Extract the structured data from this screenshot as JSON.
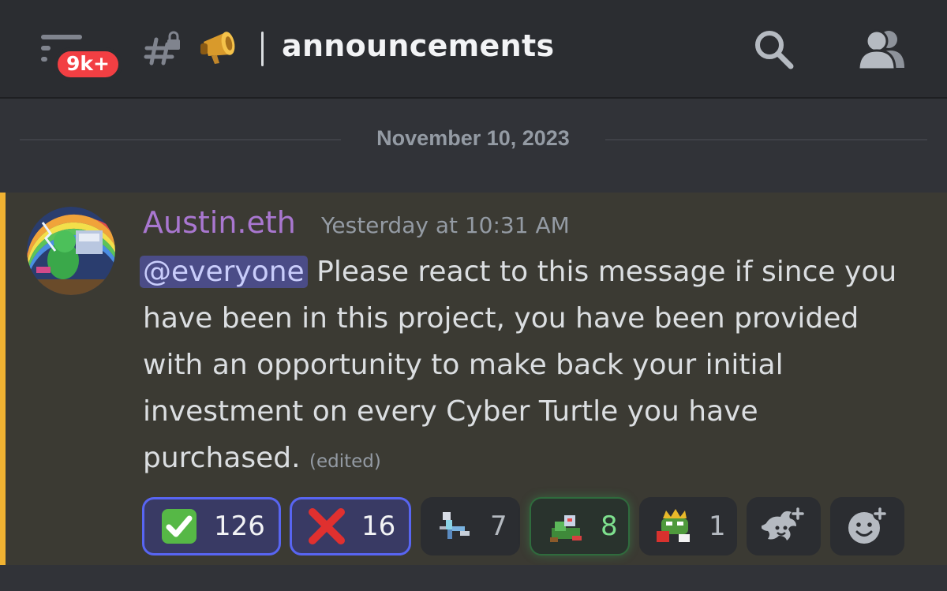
{
  "header": {
    "unread_badge": "9k+",
    "channel_name": "announcements"
  },
  "date_divider": "November 10, 2023",
  "message": {
    "author": "Austin.eth",
    "timestamp": "Yesterday at 10:31 AM",
    "mention": "@everyone",
    "text": " Please react to this message if since you have been in this project, you have been provided with an opportunity to make back your initial investment on every Cyber Turtle you have purchased.",
    "edited_label": "(edited)",
    "reactions": [
      {
        "emoji": "check-mark-emoji",
        "count": "126",
        "selected": true
      },
      {
        "emoji": "cross-mark-emoji",
        "count": "16",
        "selected": true
      },
      {
        "emoji": "pixel-character-emoji",
        "count": "7",
        "selected": false
      },
      {
        "emoji": "pixel-turtle-emoji",
        "count": "8",
        "selected": false
      },
      {
        "emoji": "crowned-frog-emoji",
        "count": "1",
        "selected": false
      }
    ]
  },
  "colors": {
    "author": "#a977d0",
    "mention_bar": "#f0b232",
    "badge": "#f23f43",
    "selected_reaction_border": "#5865f2"
  }
}
